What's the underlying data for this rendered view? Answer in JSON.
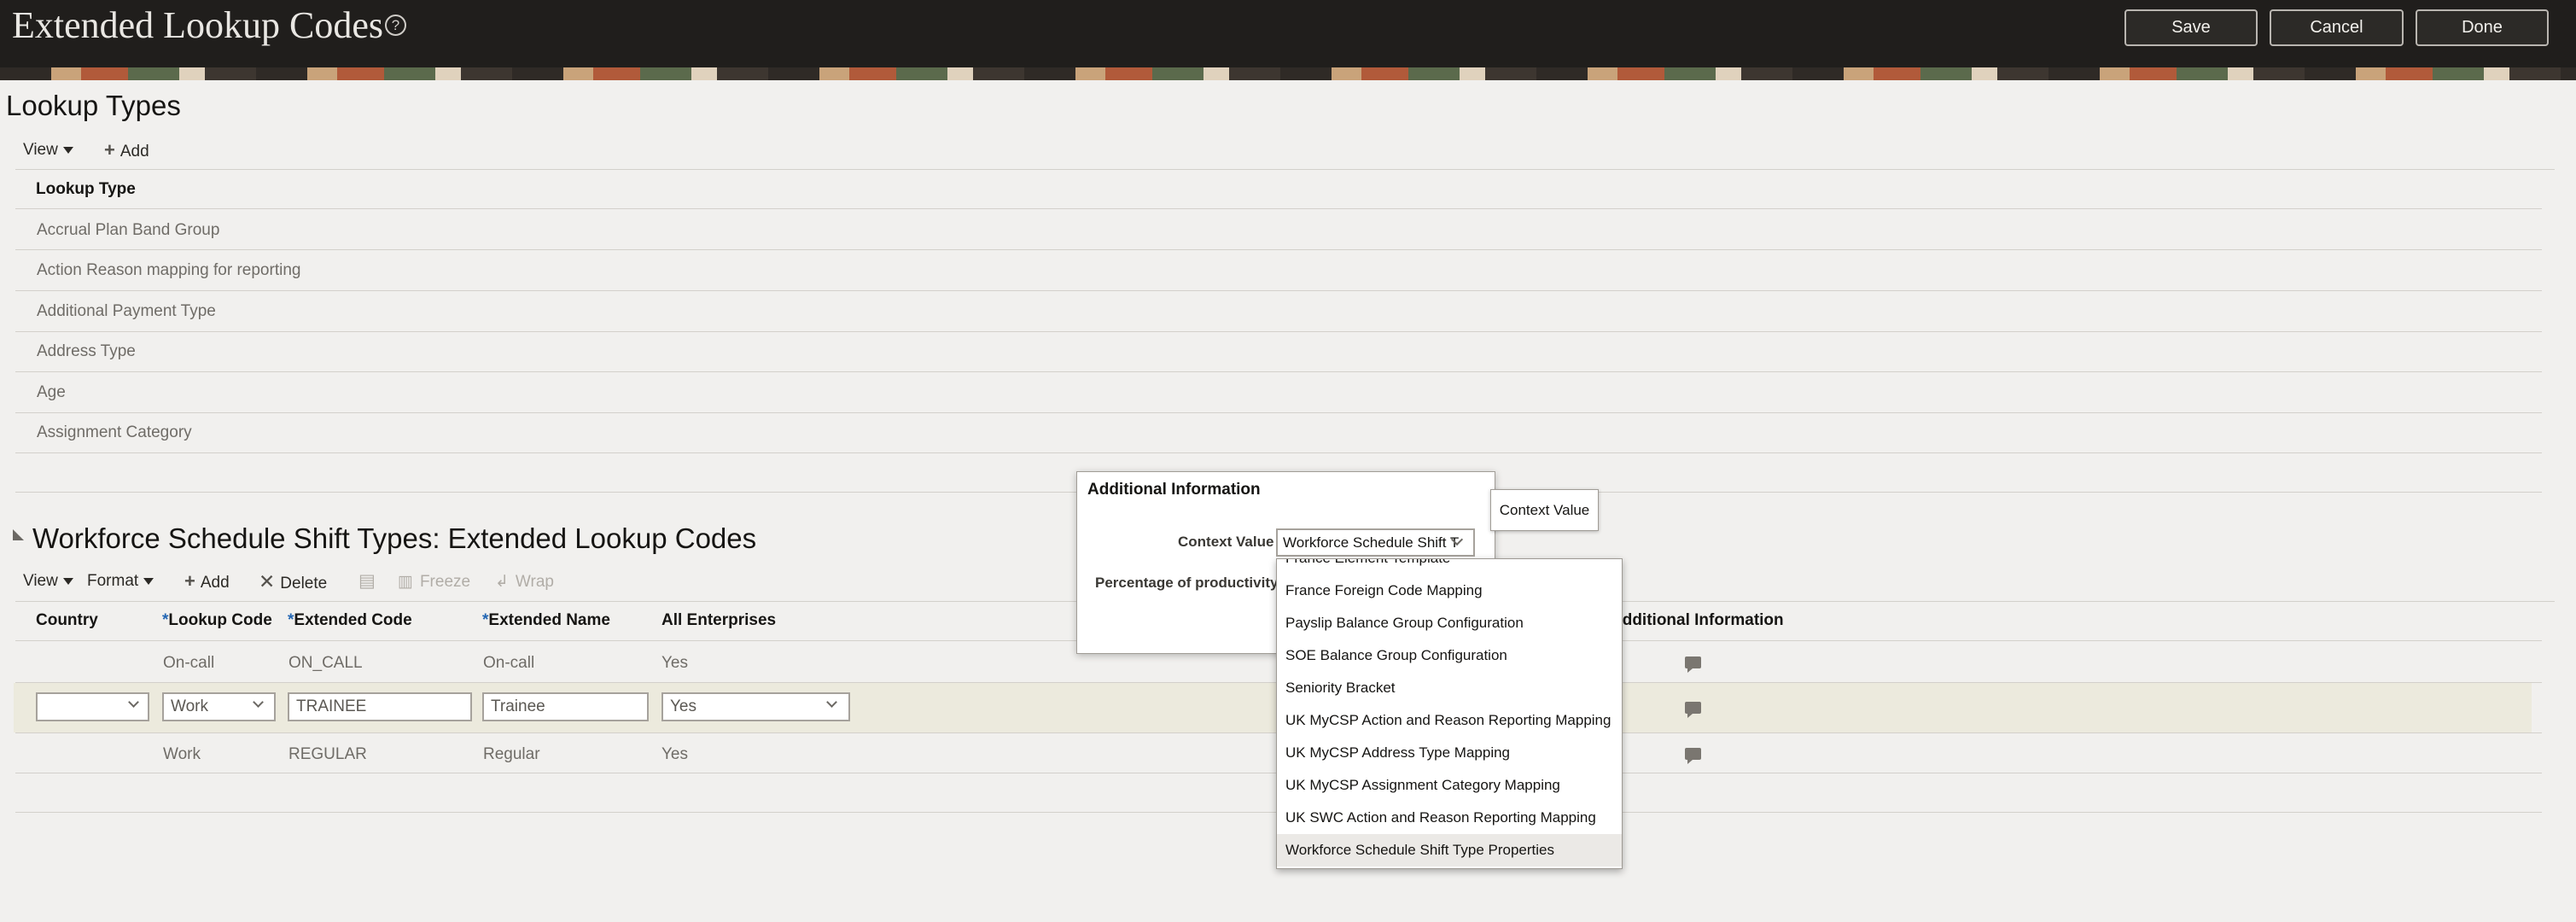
{
  "header": {
    "title": "Extended Lookup Codes",
    "help_glyph": "?",
    "buttons": {
      "save": "Save",
      "cancel": "Cancel",
      "done": "Done"
    }
  },
  "lookup_types": {
    "title": "Lookup Types",
    "toolbar": {
      "view": "View",
      "add": "Add"
    },
    "column_header": "Lookup Type",
    "rows": [
      "Accrual Plan Band Group",
      "Action Reason mapping for reporting",
      "Additional Payment Type",
      "Address Type",
      "Age",
      "Assignment Category"
    ]
  },
  "extended_codes": {
    "title": "Workforce Schedule Shift Types: Extended Lookup Codes",
    "toolbar": {
      "view": "View",
      "format": "Format",
      "add": "Add",
      "delete": "Delete",
      "freeze": "Freeze",
      "wrap": "Wrap"
    },
    "columns": {
      "country": "Country",
      "lookup_code": "Lookup Code",
      "extended_code": "Extended Code",
      "extended_name": "Extended Name",
      "all_enterprises": "All Enterprises",
      "additional_information": "Additional Information",
      "required_marker": "*"
    },
    "rows": [
      {
        "country": "",
        "lookup_code": "On-call",
        "extended_code": "ON_CALL",
        "extended_name": "On-call",
        "all_enterprises": "Yes"
      },
      {
        "country": "",
        "lookup_code": "Work",
        "extended_code": "TRAINEE",
        "extended_name": "Trainee",
        "all_enterprises": "Yes"
      },
      {
        "country": "",
        "lookup_code": "Work",
        "extended_code": "REGULAR",
        "extended_name": "Regular",
        "all_enterprises": "Yes"
      }
    ]
  },
  "dialog": {
    "title": "Additional Information",
    "context_label": "Context Value",
    "context_value": "Workforce Schedule Shift T",
    "productivity_label": "Percentage of productivity",
    "tooltip": "Context Value",
    "options": [
      "France Element Template",
      "France Foreign Code Mapping",
      "Payslip Balance Group Configuration",
      "SOE Balance Group Configuration",
      "Seniority Bracket",
      "UK MyCSP Action and Reason Reporting Mapping",
      "UK MyCSP Address Type Mapping",
      "UK MyCSP Assignment Category Mapping",
      "UK SWC Action and Reason Reporting Mapping",
      "Workforce Schedule Shift Type Properties"
    ],
    "selected_option": "Workforce Schedule Shift Type Properties"
  }
}
